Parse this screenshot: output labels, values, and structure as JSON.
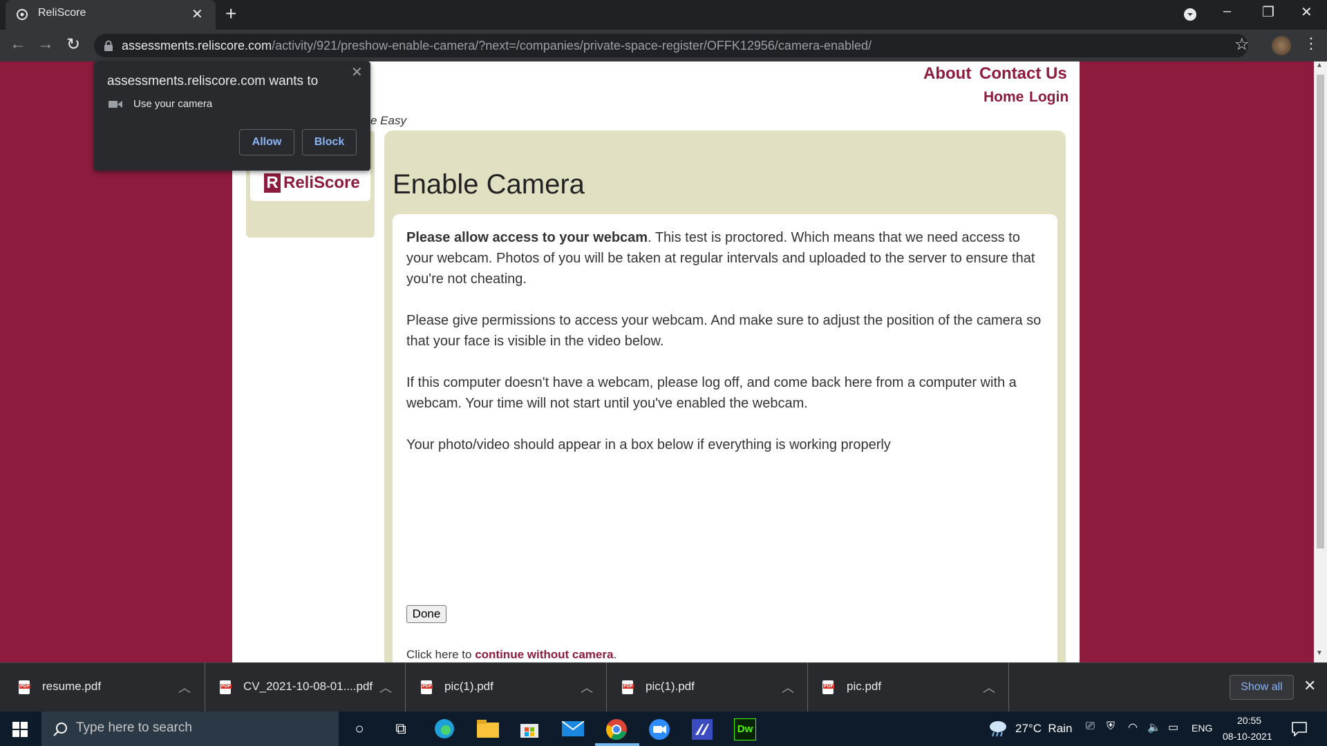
{
  "browser": {
    "tab_title": "ReliScore",
    "new_tab_symbol": "+",
    "close_symbol": "✕",
    "url_host": "assessments.reliscore.com",
    "url_path": "/activity/921/preshow-enable-camera/?next=/companies/private-space-register/OFFK12956/camera-enabled/"
  },
  "permission_popup": {
    "title": "assessments.reliscore.com wants to",
    "item": "Use your camera",
    "allow_label": "Allow",
    "block_label": "Block"
  },
  "site": {
    "nav": {
      "about": "About",
      "contact": "Contact Us",
      "home": "Home",
      "login": "Login"
    },
    "tagline_fragment": "e Easy",
    "logo_mark": "R",
    "logo_text": "ReliScore",
    "heading": "Enable Camera",
    "para1_bold": "Please allow access to your webcam",
    "para1_rest": ". This test is proctored. Which means that we need access to your webcam. Photos of you will be taken at regular intervals and uploaded to the server to ensure that you're not cheating.",
    "para2": "Please give permissions to access your webcam. And make sure to adjust the position of the camera so that your face is visible in the video below.",
    "para3": "If this computer doesn't have a webcam, please log off, and come back here from a computer with a webcam. Your time will not start until you've enabled the webcam.",
    "para4": "Your photo/video should appear in a box below if everything is working properly",
    "done_label": "Done",
    "footer_prefix": "Click here to ",
    "footer_link": "continue without camera",
    "footer_suffix": "."
  },
  "downloads": {
    "items": [
      {
        "name": "resume.pdf"
      },
      {
        "name": "CV_2021-10-08-01....pdf"
      },
      {
        "name": "pic(1).pdf"
      },
      {
        "name": "pic(1).pdf"
      },
      {
        "name": "pic.pdf"
      }
    ],
    "pdf_badge": "PDF",
    "show_all": "Show all"
  },
  "taskbar": {
    "search_placeholder": "Type here to search",
    "weather": "27°C  Rain",
    "language": "ENG",
    "time": "20:55",
    "date": "08-10-2021",
    "dw_label": "Dw"
  },
  "colors": {
    "brand": "#8d1b3d",
    "panel": "#e2e0c3",
    "link_blue": "#8ab4f8"
  }
}
